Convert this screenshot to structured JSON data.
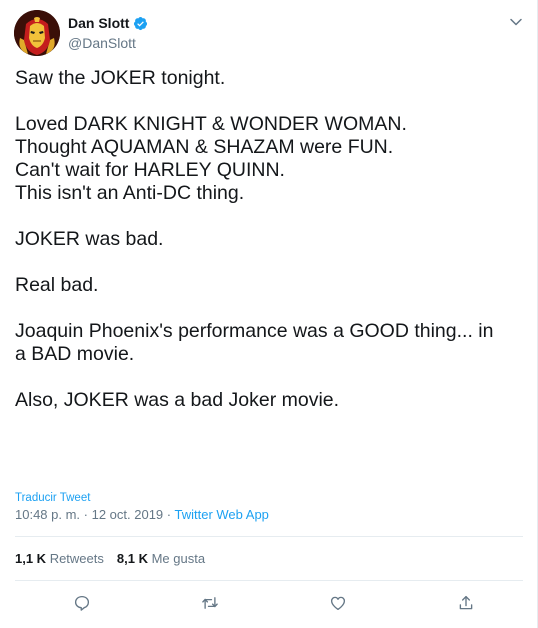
{
  "author": {
    "display_name": "Dan Slott",
    "handle": "@DanSlott",
    "verified": true,
    "avatar_icon": "iron-man-helmet-avatar"
  },
  "tweet": {
    "lines": [
      "Saw the JOKER tonight.",
      "",
      "Loved DARK KNIGHT & WONDER WOMAN.",
      "Thought AQUAMAN & SHAZAM were FUN.",
      "Can't wait for HARLEY QUINN.",
      "This isn't an Anti-DC thing.",
      "",
      "JOKER was bad.",
      "",
      "Real bad.",
      "",
      "Joaquin Phoenix's performance was a GOOD thing... in",
      "a BAD movie.",
      "",
      "Also, JOKER was a bad Joker movie."
    ]
  },
  "translate_label": "Traducir Tweet",
  "meta": {
    "time": "10:48 p. m.",
    "separator": " · ",
    "date": "12 oct. 2019",
    "source": "Twitter Web App"
  },
  "stats": {
    "retweets_count": "1,1 K",
    "retweets_label": " Retweets",
    "likes_count": "8,1 K",
    "likes_label": " Me gusta"
  },
  "actions": [
    "reply-icon",
    "retweet-icon",
    "like-icon",
    "share-icon"
  ],
  "colors": {
    "accent": "#1da1f2",
    "text": "#14171a",
    "secondary": "#657786",
    "border": "#e6ecf0"
  }
}
